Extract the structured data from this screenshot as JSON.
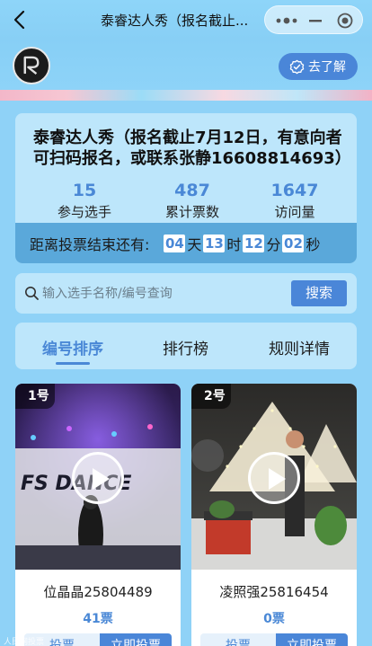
{
  "navbar": {
    "title": "泰睿达人秀（报名截止..."
  },
  "hero": {
    "learn_more_label": "去了解"
  },
  "info": {
    "title": "泰睿达人秀（报名截止7月12日，有意向者可扫码报名，或联系张静16608814693）",
    "stats": [
      {
        "value": "15",
        "label": "参与选手"
      },
      {
        "value": "487",
        "label": "累计票数"
      },
      {
        "value": "1647",
        "label": "访问量"
      }
    ],
    "countdown": {
      "label": "距离投票结束还有:",
      "days": "04",
      "days_unit": "天",
      "hours": "13",
      "hours_unit": "时",
      "minutes": "12",
      "minutes_unit": "分",
      "seconds": "02",
      "seconds_unit": "秒"
    }
  },
  "search": {
    "placeholder": "输入选手名称/编号查询",
    "button_label": "搜索"
  },
  "tabs": [
    {
      "label": "编号排序",
      "active": true
    },
    {
      "label": "排行榜",
      "active": false
    },
    {
      "label": "规则详情",
      "active": false
    }
  ],
  "contestants": [
    {
      "badge": "1号",
      "name": "位晶晶25804489",
      "votes": "41票",
      "btn_left": "投票",
      "btn_right": "立即投票"
    },
    {
      "badge": "2号",
      "name": "凌照强25816454",
      "votes": "0票",
      "btn_left": "投票",
      "btn_right": "立即投票"
    }
  ],
  "watermark": "人民网投票",
  "colors": {
    "accent": "#4a86d8",
    "background": "#8fd2f7",
    "card": "#bde6fb"
  }
}
